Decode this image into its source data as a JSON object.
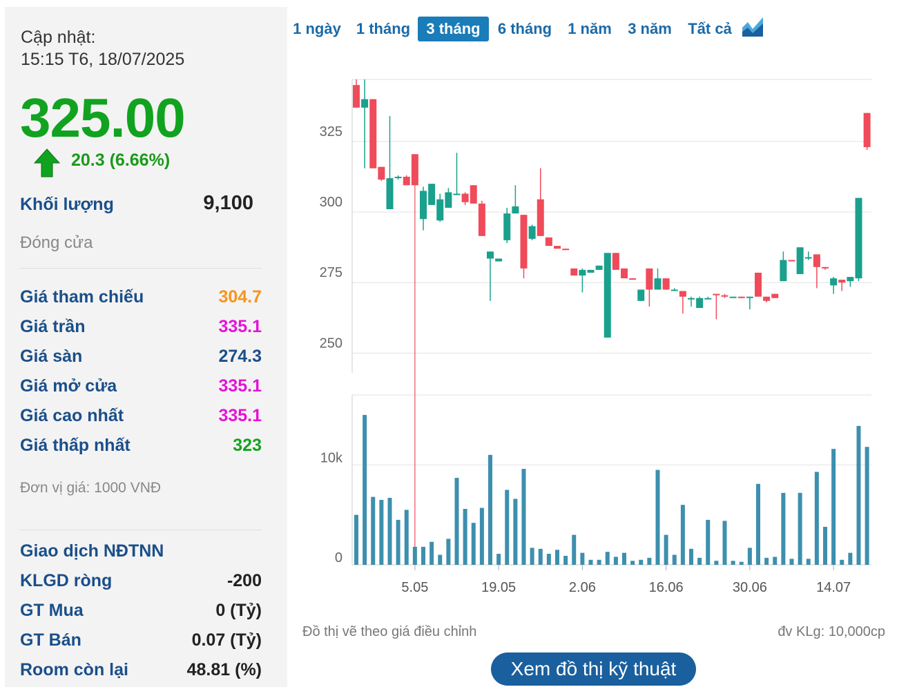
{
  "left": {
    "update_label": "Cập nhật:",
    "update_time": "15:15 T6, 18/07/2025",
    "price": "325.00",
    "change": "20.3 (6.66%)",
    "volume_label": "Khối lượng",
    "volume_value": "9,100",
    "status": "Đóng cửa",
    "prices": [
      {
        "label": "Giá tham chiếu",
        "value": "304.7",
        "color": "#f7941d"
      },
      {
        "label": "Giá trần",
        "value": "335.1",
        "color": "#e413d6"
      },
      {
        "label": "Giá sàn",
        "value": "274.3",
        "color": "#1a4f8a"
      },
      {
        "label": "Giá mở cửa",
        "value": "335.1",
        "color": "#e413d6"
      },
      {
        "label": "Giá cao nhất",
        "value": "335.1",
        "color": "#e413d6"
      },
      {
        "label": "Giá thấp nhất",
        "value": "323",
        "color": "#11a31f"
      }
    ],
    "unit": "Đơn vị giá: 1000 VNĐ",
    "foreign_title": "Giao dịch NĐTNN",
    "foreign": [
      {
        "label": "KLGD ròng",
        "value": "-200"
      },
      {
        "label": "GT Mua",
        "value": "0 (Tỷ)"
      },
      {
        "label": "GT Bán",
        "value": "0.07 (Tỷ)"
      },
      {
        "label": "Room còn lại",
        "value": "48.81 (%)"
      }
    ]
  },
  "tabs": [
    "1 ngày",
    "1 tháng",
    "3 tháng",
    "6 tháng",
    "1 năm",
    "3 năm",
    "Tất cả"
  ],
  "active_tab": "3 tháng",
  "footer": {
    "note_left": "Đồ thị vẽ theo giá điều chỉnh",
    "note_right": "đv KLg: 10,000cp",
    "button": "Xem đồ thị kỹ thuật"
  },
  "colors": {
    "up": "#1aa08c",
    "down": "#ef4b5a",
    "volume": "#3d8fae"
  },
  "chart_data": {
    "type": "candlestick",
    "price_ticks": [
      325,
      300,
      275,
      250
    ],
    "price_ylim": [
      243,
      347
    ],
    "volume_ticks": [
      "10k",
      "0"
    ],
    "volume_ylim": [
      0,
      17000
    ],
    "x_ticks": [
      "5.05",
      "19.05",
      "2.06",
      "16.06",
      "30.06",
      "14.07"
    ],
    "x_tick_index": [
      7,
      17,
      27,
      37,
      47,
      57
    ],
    "candles": [
      [
        345.0,
        337.0,
        347.0,
        337.0,
        5000
      ],
      [
        337.0,
        340.0,
        347.0,
        315.5,
        15000
      ],
      [
        340.0,
        315.5,
        340.0,
        315.5,
        6800
      ],
      [
        316.0,
        311.5,
        316.0,
        311.0,
        6500
      ],
      [
        301.0,
        312.0,
        334.0,
        301.0,
        6700
      ],
      [
        312.0,
        312.5,
        313.0,
        311.5,
        4500
      ],
      [
        312.5,
        309.5,
        313.0,
        309.5,
        5500
      ],
      [
        320.5,
        309.5,
        320.5,
        309.5,
        1800
      ],
      [
        297.5,
        307.5,
        309.0,
        293.5,
        1800
      ],
      [
        302.5,
        310.0,
        310.0,
        302.5,
        2300
      ],
      [
        297.0,
        304.5,
        306.5,
        296.5,
        1000
      ],
      [
        301.5,
        307.0,
        308.5,
        301.5,
        2600
      ],
      [
        306.0,
        306.5,
        321.0,
        306.0,
        8700
      ],
      [
        306.5,
        303.5,
        307.0,
        302.5,
        5600
      ],
      [
        309.5,
        303.0,
        309.5,
        303.0,
        4200
      ],
      [
        303.0,
        291.5,
        304.0,
        291.5,
        5700
      ],
      [
        283.5,
        286.0,
        286.0,
        268.5,
        11000
      ],
      [
        282.5,
        283.5,
        283.5,
        282.5,
        1100
      ],
      [
        290.0,
        299.5,
        301.5,
        289.0,
        7500
      ],
      [
        299.5,
        302.0,
        309.5,
        299.5,
        6600
      ],
      [
        299.0,
        280.0,
        299.0,
        276.5,
        9600
      ],
      [
        290.5,
        295.0,
        295.5,
        290.0,
        1700
      ],
      [
        304.5,
        291.5,
        315.5,
        291.5,
        1600
      ],
      [
        291.0,
        288.0,
        291.0,
        288.0,
        1100
      ],
      [
        288.0,
        287.0,
        288.0,
        287.0,
        1500
      ],
      [
        287.0,
        286.5,
        287.0,
        286.5,
        900
      ],
      [
        280.0,
        277.5,
        280.0,
        277.5,
        3000
      ],
      [
        277.5,
        279.5,
        280.0,
        271.5,
        1200
      ],
      [
        278.5,
        279.5,
        279.5,
        278.5,
        500
      ],
      [
        279.5,
        281.0,
        281.0,
        279.5,
        500
      ],
      [
        255.5,
        285.5,
        285.5,
        255.5,
        1300
      ],
      [
        285.5,
        279.5,
        285.5,
        279.5,
        800
      ],
      [
        280.0,
        276.5,
        280.0,
        276.5,
        1200
      ],
      [
        276.5,
        276.0,
        276.5,
        276.0,
        400
      ],
      [
        268.5,
        272.5,
        272.5,
        268.5,
        500
      ],
      [
        280.0,
        272.5,
        280.0,
        266.5,
        700
      ],
      [
        272.5,
        276.5,
        280.0,
        272.5,
        9500
      ],
      [
        276.5,
        272.5,
        276.5,
        272.5,
        3000
      ],
      [
        272.5,
        272.5,
        273.0,
        272.5,
        1000
      ],
      [
        272.0,
        270.0,
        272.0,
        264.0,
        6000
      ],
      [
        269.5,
        269.5,
        270.0,
        266.5,
        1600
      ],
      [
        266.0,
        269.5,
        270.0,
        266.0,
        700
      ],
      [
        269.5,
        269.5,
        270.0,
        269.5,
        4500
      ],
      [
        271.0,
        270.5,
        271.0,
        262.0,
        400
      ],
      [
        270.5,
        270.0,
        271.0,
        269.5,
        4400
      ],
      [
        270.0,
        270.0,
        270.0,
        270.0,
        400
      ],
      [
        270.0,
        269.5,
        270.0,
        269.5,
        300
      ],
      [
        270.0,
        270.0,
        270.0,
        265.5,
        1700
      ],
      [
        278.5,
        270.0,
        278.5,
        270.0,
        8100
      ],
      [
        270.0,
        268.5,
        270.0,
        268.0,
        700
      ],
      [
        271.0,
        269.5,
        271.0,
        269.5,
        800
      ],
      [
        275.5,
        283.0,
        286.0,
        275.5,
        7200
      ],
      [
        283.0,
        282.5,
        283.0,
        282.5,
        600
      ],
      [
        278.0,
        287.5,
        287.5,
        278.0,
        7200
      ],
      [
        283.5,
        284.0,
        286.0,
        283.0,
        600
      ],
      [
        285.0,
        280.5,
        285.0,
        273.0,
        9300
      ],
      [
        280.5,
        280.0,
        280.5,
        279.5,
        3800
      ],
      [
        274.0,
        276.5,
        277.0,
        271.0,
        11600
      ],
      [
        276.0,
        275.0,
        276.0,
        272.0,
        500
      ],
      [
        275.5,
        277.0,
        277.0,
        273.5,
        1200
      ],
      [
        276.5,
        305.0,
        305.0,
        275.5,
        13900
      ],
      [
        335.1,
        323.0,
        335.1,
        322.0,
        11800
      ]
    ]
  }
}
